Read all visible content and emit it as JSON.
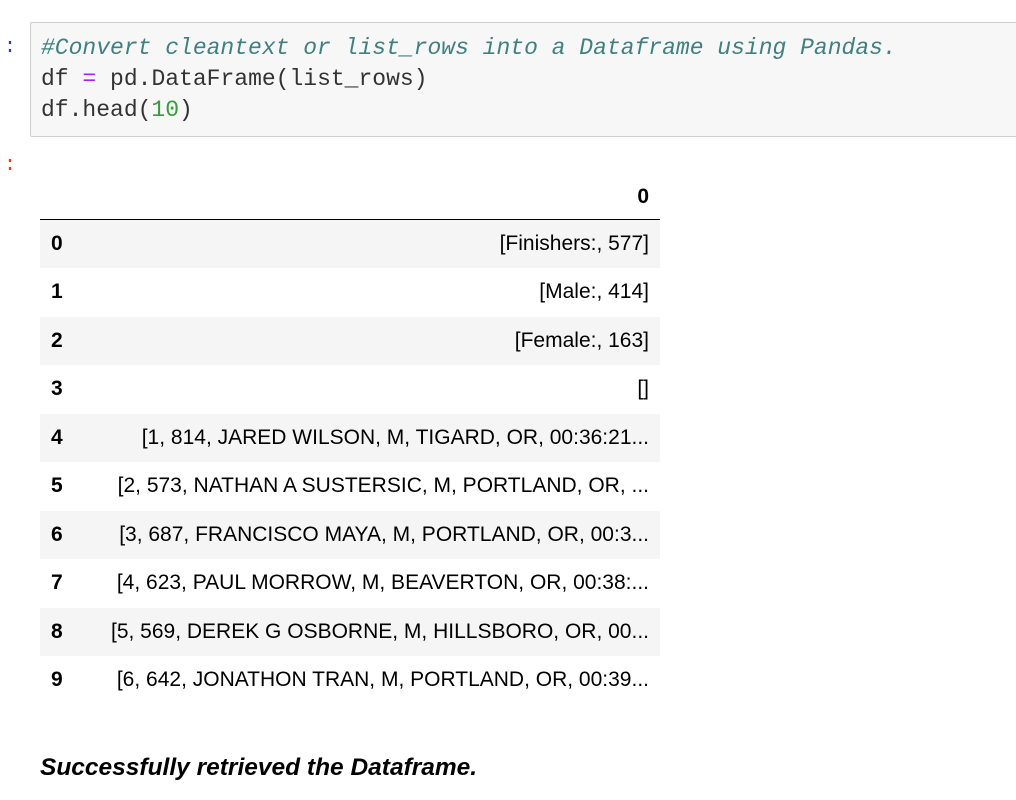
{
  "input_prompt": ":",
  "output_prompt": ":",
  "code": {
    "line1_comment": "#Convert cleantext or list_rows into a Dataframe using Pandas.",
    "line2_var": "df",
    "line2_op": "=",
    "line2_rest": "pd.DataFrame(list_rows)",
    "line3_call": "df.head(",
    "line3_arg": "10",
    "line3_close": ")"
  },
  "dataframe": {
    "column_header": "0",
    "rows": [
      {
        "index": "0",
        "value": "[Finishers:, 577]"
      },
      {
        "index": "1",
        "value": "[Male:, 414]"
      },
      {
        "index": "2",
        "value": "[Female:, 163]"
      },
      {
        "index": "3",
        "value": "[]"
      },
      {
        "index": "4",
        "value": "[1, 814, JARED WILSON, M, TIGARD, OR, 00:36:21..."
      },
      {
        "index": "5",
        "value": "[2, 573, NATHAN A SUSTERSIC, M, PORTLAND, OR, ..."
      },
      {
        "index": "6",
        "value": "[3, 687, FRANCISCO MAYA, M, PORTLAND, OR, 00:3..."
      },
      {
        "index": "7",
        "value": "[4, 623, PAUL MORROW, M, BEAVERTON, OR, 00:38:..."
      },
      {
        "index": "8",
        "value": "[5, 569, DEREK G OSBORNE, M, HILLSBORO, OR, 00..."
      },
      {
        "index": "9",
        "value": "[6, 642, JONATHON TRAN, M, PORTLAND, OR, 00:39..."
      }
    ]
  },
  "status_message": "Successfully retrieved the Dataframe.",
  "colors": {
    "comment": "#408080",
    "operator": "#aa22ff",
    "number": "#3b9a3b",
    "input_prompt": "#303f9f",
    "output_prompt": "#d84315",
    "row_stripe": "#f5f5f5"
  }
}
